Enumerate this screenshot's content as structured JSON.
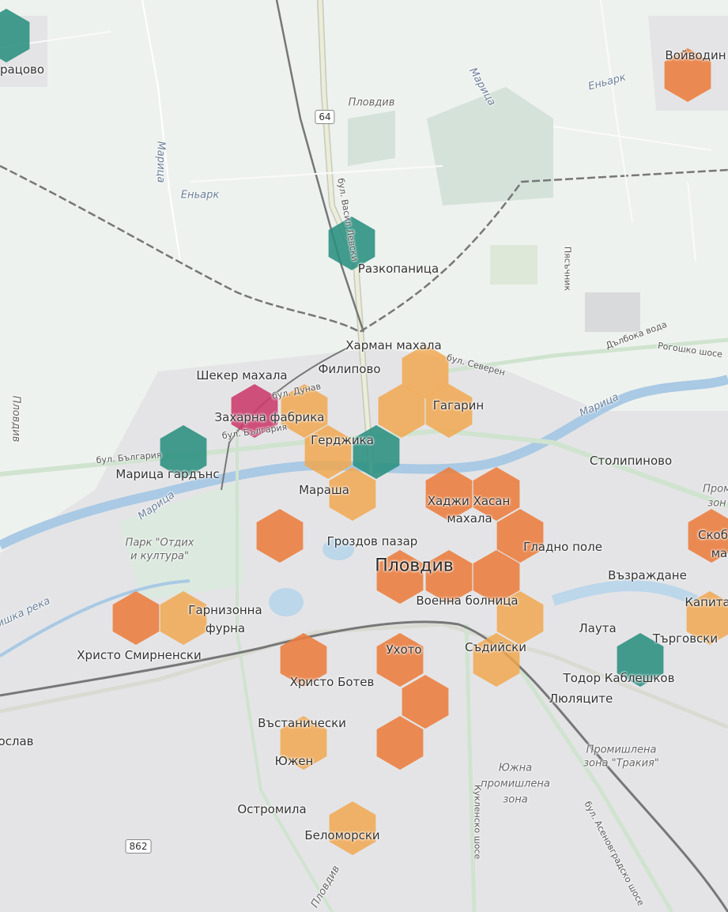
{
  "colors": {
    "teal": "#2a8f80",
    "orange": "#ea7d3e",
    "light_orange": "#f2a64a",
    "magenta": "#cb3a6a"
  },
  "map": {
    "labels": {
      "voyvodinovo": "Войводин",
      "bratsovo": "рацово",
      "plovdiv_north": "Пловдив",
      "maritsa_nw": "Марица",
      "maritsa_ne": "Марица",
      "eniark_w": "Еньарк",
      "eniark_ne": "Еньарк",
      "razkopanitsa": "Разкопаница",
      "harman": "Харман махала",
      "filipovo": "Филипово",
      "sheker": "Шекер махала",
      "zaharna": "Захарна фабрика",
      "gagarin": "Гагарин",
      "gerdzhika": "Герджика",
      "maritsa_gardens": "Марица гардънс",
      "stolipinovo": "Столипиново",
      "marasha": "Мараша",
      "hadzhi_hasan_1": "Хаджи Хасан",
      "hadzhi_hasan_2": "махала",
      "grozdov": "Гроздов пазар",
      "gladno": "Гладно поле",
      "plovdiv_center": "Пловдив",
      "vazrazhdane": "Възраждане",
      "voenna": "Военна болница",
      "garnizonna_1": "Гарнизонна",
      "garnizonna_2": "фурна",
      "hristo_smirnenski": "Христо Смирненски",
      "lauta": "Лаута",
      "targovski": "Търговски",
      "uhoto": "Ухото",
      "sadiyski": "Съдийски",
      "hristo_botev": "Христо Ботев",
      "todor_kableshkov": "Тодор Каблешков",
      "lyulyatsite": "Люляците",
      "vastanicheski": "Въстанически",
      "yuzhen": "Южен",
      "yuzhna_1": "Южна",
      "yuzhna_2": "промишлена",
      "yuzhna_3": "зона",
      "promishlena_trakia_1": "Промишлена",
      "promishlena_trakia_2": "зона \"Тракия\"",
      "ostromila": "Остромила",
      "belomorski": "Беломорски",
      "slav": "ослав",
      "skob_1": "Скоб",
      "skob_2": "ма",
      "kapita": "Капита",
      "prom_1": "Пром",
      "prom_2": "зон",
      "park_1": "Парк \"Отдих",
      "park_2": "и култура\"",
      "plovdiv_west": "Пловдив",
      "maritsa_mid": "Марица",
      "reka": "ишка река",
      "bul_dunav": "бул. Дунав",
      "bul_bulgaria_1": "бул. България",
      "bul_bulgaria_2": "бул. България",
      "bul_sever": "бул. Северен",
      "bul_vasil": "бул. Васил Левски",
      "pyasachnik": "Пясъчник",
      "dalboka": "Дълбока вода",
      "rogoshko": "Рогошко шосе",
      "kuklensko": "Кукленско шосе",
      "asenovgradsko": "бул. Асеновградско шосе",
      "plovdiv_south": "Пловдив",
      "maritsa_e": "Марица"
    },
    "shields": {
      "r64": "64",
      "r862": "862"
    }
  },
  "hexbins": [
    {
      "color": "teal",
      "q": 0,
      "r": 0
    },
    {
      "color": "orange",
      "q": 0,
      "r": 0
    },
    {
      "color": "teal",
      "q": 0,
      "r": 0
    }
  ]
}
